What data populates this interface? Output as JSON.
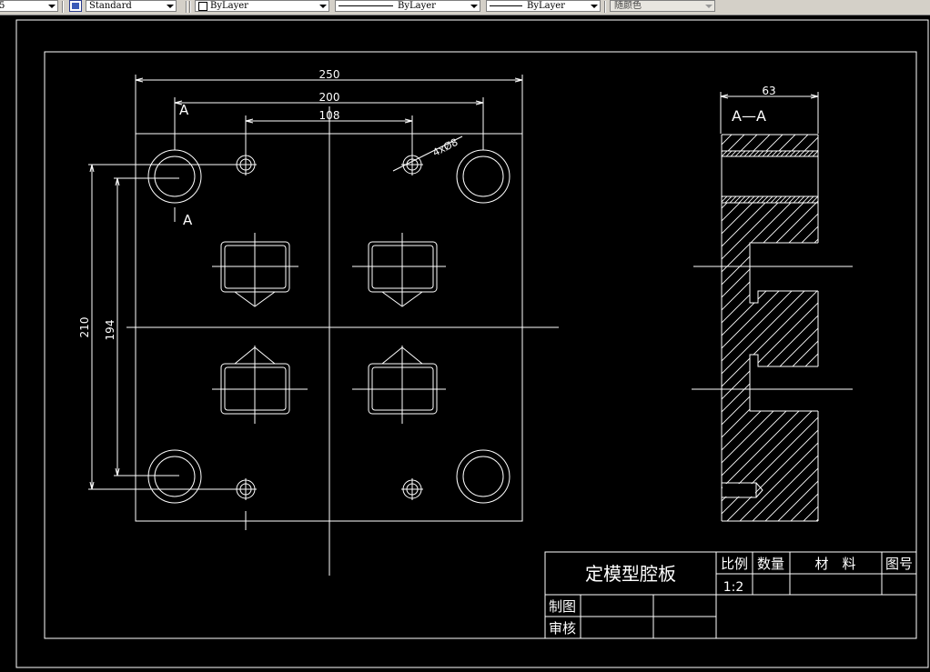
{
  "toolbar": {
    "partial_left": "5",
    "text_style": "Standard",
    "layer": "ByLayer",
    "linetype": "ByLayer",
    "lineweight": "ByLayer",
    "plot_style": "随颜色"
  },
  "drawing": {
    "front_view": {
      "dim_250": "250",
      "dim_200": "200",
      "dim_108": "108",
      "dim_210": "210",
      "dim_194": "194",
      "hole_callout": "4xØ8",
      "section_mark_top": "A",
      "section_mark_bottom": "A"
    },
    "section_view": {
      "dim_63": "63",
      "label": "A—A"
    },
    "title_block": {
      "part_name": "定模型腔板",
      "scale_header": "比例",
      "qty_header": "数量",
      "material_header": "材　料",
      "drawing_no_header": "图号",
      "scale_value": "1:2",
      "drawn_by": "制图",
      "checked_by": "审核"
    }
  }
}
